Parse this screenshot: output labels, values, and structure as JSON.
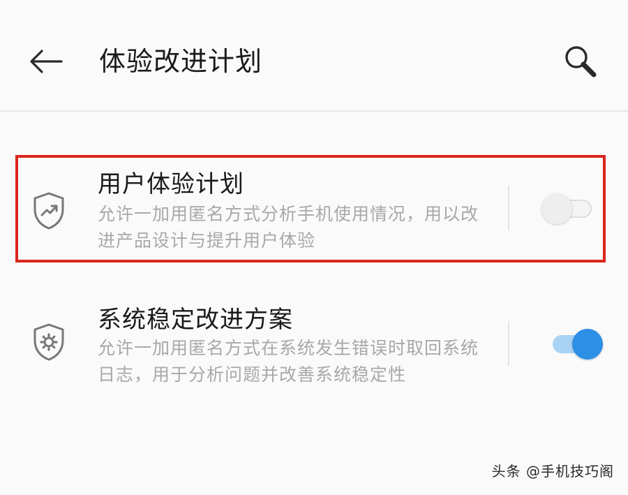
{
  "header": {
    "back_icon": "arrow-left-icon",
    "title": "体验改进计划",
    "search_icon": "search-icon"
  },
  "settings": [
    {
      "icon": "shield-trend-icon",
      "title": "用户体验计划",
      "description": "允许一加用匿名方式分析手机使用情况，用以改进产品设计与提升用户体验",
      "enabled": false
    },
    {
      "icon": "shield-gear-icon",
      "title": "系统稳定改进方案",
      "description": "允许一加用匿名方式在系统发生错误时取回系统日志，用于分析问题并改善系统稳定性",
      "enabled": true
    }
  ],
  "highlight": {
    "color": "#d9261c"
  },
  "colors": {
    "accent": "#2d8fe6",
    "accent_track": "#a9d3f5",
    "background": "#fafafa"
  },
  "watermark": {
    "text": "头条 @手机技巧阁"
  }
}
